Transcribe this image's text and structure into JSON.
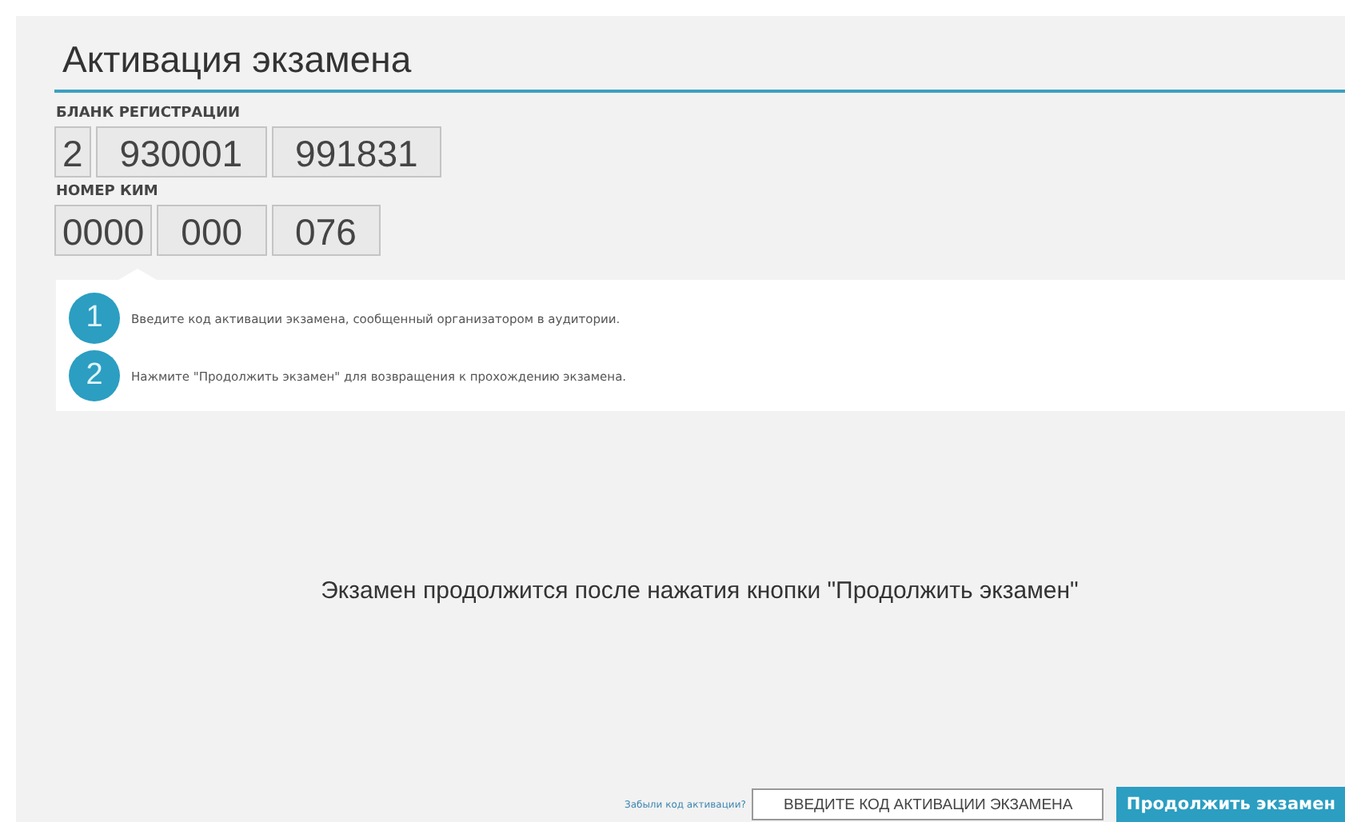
{
  "title": "Активация экзамена",
  "groups": [
    {
      "label": "БЛАНК РЕГИСТРАЦИИ",
      "fields": [
        "2",
        "930001",
        "991831"
      ]
    },
    {
      "label": "НОМЕР КИМ",
      "fields": [
        "0000",
        "000",
        "076"
      ]
    }
  ],
  "steps": [
    {
      "number": "1",
      "text": "Введите код активации экзамена, сообщенный организатором в аудитории."
    },
    {
      "number": "2",
      "text": "Нажмите \"Продолжить экзамен\" для возвращения к прохождению экзамена."
    }
  ],
  "message": "Экзамен продолжится после нажатия кнопки \"Продолжить экзамен\"",
  "footer": {
    "forgot_link": "Забыли код активации?",
    "code_field": {
      "placeholder": "ВВЕДИТЕ КОД АКТИВАЦИИ ЭКЗАМЕНА"
    },
    "button": "Продолжить экзамен"
  }
}
